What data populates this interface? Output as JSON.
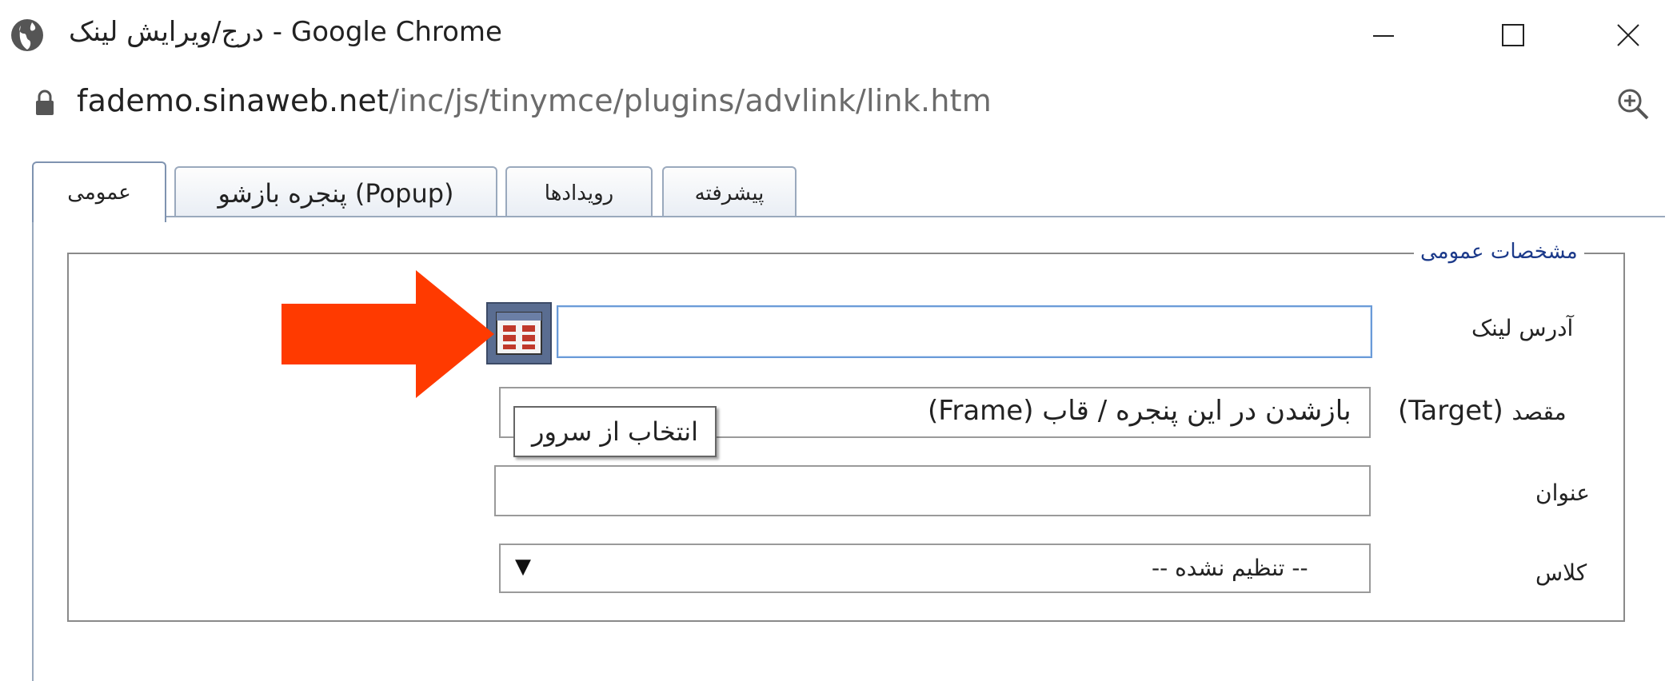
{
  "window": {
    "title": "درج/ویرایش لینک - Google Chrome",
    "controls": {
      "minimize": "minimize-icon",
      "maximize": "maximize-icon",
      "close": "close-icon"
    }
  },
  "address_bar": {
    "domain": "fademo.sinaweb.net",
    "path": "/inc/js/tinymce/plugins/advlink/link.htm"
  },
  "tabs": [
    {
      "label": "عمومی",
      "active": true
    },
    {
      "label": "پنجره بازشو (Popup)",
      "active": false
    },
    {
      "label": "رویدادها",
      "active": false
    },
    {
      "label": "پیشرفته",
      "active": false
    }
  ],
  "fieldset": {
    "legend": "مشخصات عمومی",
    "link_address": {
      "label": "آدرس لینک",
      "value": ""
    },
    "target": {
      "label_fa": "مقصد",
      "label_en": "(Target)",
      "value": "بازشدن در این پنجره / قاب (Frame)"
    },
    "title": {
      "label": "عنوان",
      "value": ""
    },
    "class": {
      "label": "کلاس",
      "value": "-- تنظیم نشده --"
    }
  },
  "tooltip": {
    "text": "انتخاب از سرور"
  },
  "colors": {
    "arrow": "#ff3a00",
    "legend": "#1c3a8a",
    "tab_border": "#9aa9bd",
    "browse_button": "#5a6d91",
    "focus_border": "#6a9bd8"
  }
}
